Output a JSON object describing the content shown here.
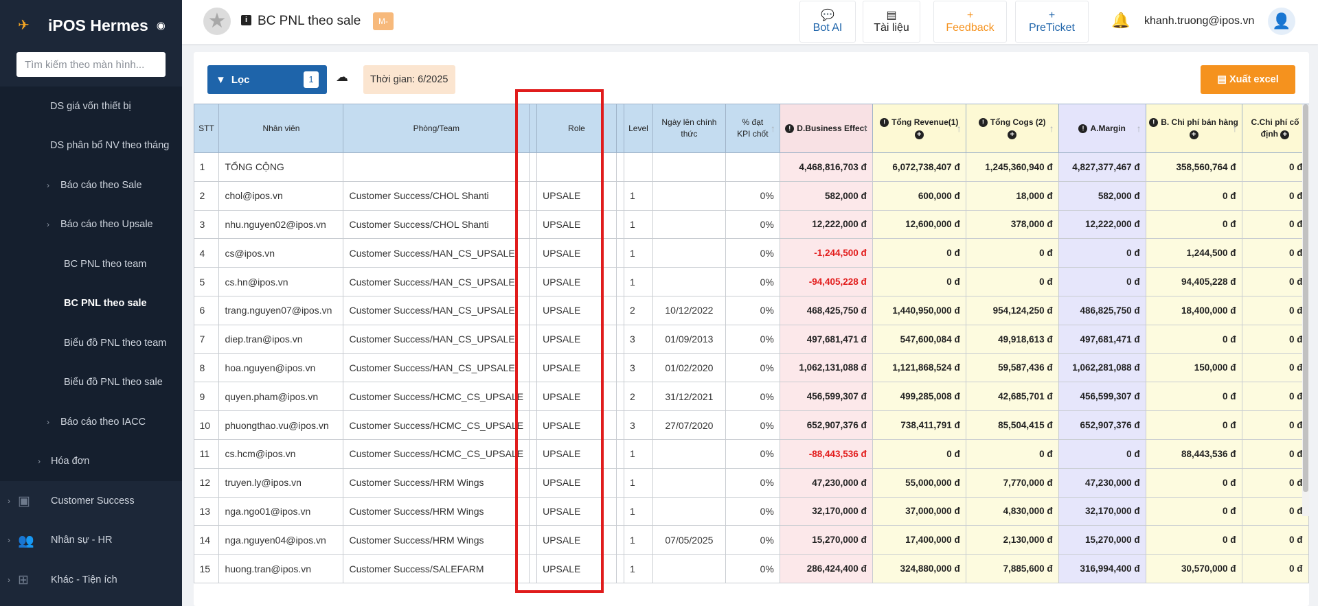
{
  "app": {
    "name": "iPOS Hermes"
  },
  "sidebar": {
    "search_placeholder": "Tìm kiếm theo màn hình...",
    "items": [
      {
        "label": "DS giá vốn thiết bị"
      },
      {
        "label": "DS phân bổ NV theo tháng"
      },
      {
        "label": "Báo cáo theo Sale"
      },
      {
        "label": "Báo cáo theo Upsale"
      },
      {
        "label": "BC PNL theo team"
      },
      {
        "label": "BC PNL theo sale"
      },
      {
        "label": "Biểu đồ PNL theo team"
      },
      {
        "label": "Biểu đồ PNL theo sale"
      },
      {
        "label": "Báo cáo theo IACC"
      },
      {
        "label": "Hóa đơn"
      }
    ],
    "groups": [
      {
        "label": "Customer Success"
      },
      {
        "label": "Nhân sự - HR"
      },
      {
        "label": "Khác - Tiện ích"
      }
    ]
  },
  "topbar": {
    "page_title": "BC PNL theo sale",
    "badge": "M-",
    "buttons": [
      {
        "label": "Bot AI",
        "color": "#1e64aa"
      },
      {
        "label": "Tài liệu",
        "color": "#222222"
      },
      {
        "label": "Feedback",
        "color": "#f5921e"
      },
      {
        "label": "PreTicket",
        "color": "#1e64aa"
      }
    ],
    "user_email": "khanh.truong@ipos.vn"
  },
  "toolbar": {
    "filter_label": "Lọc",
    "filter_count": "1",
    "time_label": "Thời gian: 6/2025",
    "export_label": "Xuất excel"
  },
  "table": {
    "headers": {
      "stt": "STT",
      "employee": "Nhân viên",
      "team": "Phòng/Team",
      "role": "Role",
      "level": "Level",
      "official_date": "Ngày lên chính thức",
      "kpi": "% đạt KPI chốt",
      "business_effect": "D.Business Effect",
      "revenue": "Tổng Revenue(1)",
      "cogs": "Tổng Cogs (2)",
      "margin": "A.Margin",
      "selling_cost": "B. Chi phí bán hàng",
      "fixed_cost": "C.Chi phí cố định"
    },
    "rows": [
      {
        "stt": "1",
        "employee": "TỔNG CỘNG",
        "team": "",
        "role": "",
        "level": "",
        "date": "",
        "kpi": "",
        "be": "4,468,816,703 đ",
        "rev": "6,072,738,407 đ",
        "cogs": "1,245,360,940 đ",
        "margin": "4,827,377,467 đ",
        "sell": "358,560,764 đ",
        "fixed": "0 đ"
      },
      {
        "stt": "2",
        "employee": "chol@ipos.vn",
        "team": "Customer Success/CHOL Shanti",
        "role": "UPSALE",
        "level": "1",
        "date": "",
        "kpi": "0%",
        "be": "582,000 đ",
        "rev": "600,000 đ",
        "cogs": "18,000 đ",
        "margin": "582,000 đ",
        "sell": "0 đ",
        "fixed": "0 đ"
      },
      {
        "stt": "3",
        "employee": "nhu.nguyen02@ipos.vn",
        "team": "Customer Success/CHOL Shanti",
        "role": "UPSALE",
        "level": "1",
        "date": "",
        "kpi": "0%",
        "be": "12,222,000 đ",
        "rev": "12,600,000 đ",
        "cogs": "378,000 đ",
        "margin": "12,222,000 đ",
        "sell": "0 đ",
        "fixed": "0 đ"
      },
      {
        "stt": "4",
        "employee": "cs@ipos.vn",
        "team": "Customer Success/HAN_CS_UPSALE",
        "role": "UPSALE",
        "level": "1",
        "date": "",
        "kpi": "0%",
        "be": "-1,244,500 đ",
        "neg": true,
        "rev": "0 đ",
        "cogs": "0 đ",
        "margin": "0 đ",
        "sell": "1,244,500 đ",
        "fixed": "0 đ"
      },
      {
        "stt": "5",
        "employee": "cs.hn@ipos.vn",
        "team": "Customer Success/HAN_CS_UPSALE",
        "role": "UPSALE",
        "level": "1",
        "date": "",
        "kpi": "0%",
        "be": "-94,405,228 đ",
        "neg": true,
        "rev": "0 đ",
        "cogs": "0 đ",
        "margin": "0 đ",
        "sell": "94,405,228 đ",
        "fixed": "0 đ"
      },
      {
        "stt": "6",
        "employee": "trang.nguyen07@ipos.vn",
        "team": "Customer Success/HAN_CS_UPSALE",
        "role": "UPSALE",
        "level": "2",
        "date": "10/12/2022",
        "kpi": "0%",
        "be": "468,425,750 đ",
        "rev": "1,440,950,000 đ",
        "cogs": "954,124,250 đ",
        "margin": "486,825,750 đ",
        "sell": "18,400,000 đ",
        "fixed": "0 đ"
      },
      {
        "stt": "7",
        "employee": "diep.tran@ipos.vn",
        "team": "Customer Success/HAN_CS_UPSALE",
        "role": "UPSALE",
        "level": "3",
        "date": "01/09/2013",
        "kpi": "0%",
        "be": "497,681,471 đ",
        "rev": "547,600,084 đ",
        "cogs": "49,918,613 đ",
        "margin": "497,681,471 đ",
        "sell": "0 đ",
        "fixed": "0 đ"
      },
      {
        "stt": "8",
        "employee": "hoa.nguyen@ipos.vn",
        "team": "Customer Success/HAN_CS_UPSALE",
        "role": "UPSALE",
        "level": "3",
        "date": "01/02/2020",
        "kpi": "0%",
        "be": "1,062,131,088 đ",
        "rev": "1,121,868,524 đ",
        "cogs": "59,587,436 đ",
        "margin": "1,062,281,088 đ",
        "sell": "150,000 đ",
        "fixed": "0 đ"
      },
      {
        "stt": "9",
        "employee": "quyen.pham@ipos.vn",
        "team": "Customer Success/HCMC_CS_UPSALE",
        "role": "UPSALE",
        "level": "2",
        "date": "31/12/2021",
        "kpi": "0%",
        "be": "456,599,307 đ",
        "rev": "499,285,008 đ",
        "cogs": "42,685,701 đ",
        "margin": "456,599,307 đ",
        "sell": "0 đ",
        "fixed": "0 đ"
      },
      {
        "stt": "10",
        "employee": "phuongthao.vu@ipos.vn",
        "team": "Customer Success/HCMC_CS_UPSALE",
        "role": "UPSALE",
        "level": "3",
        "date": "27/07/2020",
        "kpi": "0%",
        "be": "652,907,376 đ",
        "rev": "738,411,791 đ",
        "cogs": "85,504,415 đ",
        "margin": "652,907,376 đ",
        "sell": "0 đ",
        "fixed": "0 đ"
      },
      {
        "stt": "11",
        "employee": "cs.hcm@ipos.vn",
        "team": "Customer Success/HCMC_CS_UPSALE",
        "role": "UPSALE",
        "level": "1",
        "date": "",
        "kpi": "0%",
        "be": "-88,443,536 đ",
        "neg": true,
        "rev": "0 đ",
        "cogs": "0 đ",
        "margin": "0 đ",
        "sell": "88,443,536 đ",
        "fixed": "0 đ"
      },
      {
        "stt": "12",
        "employee": "truyen.ly@ipos.vn",
        "team": "Customer Success/HRM Wings",
        "role": "UPSALE",
        "level": "1",
        "date": "",
        "kpi": "0%",
        "be": "47,230,000 đ",
        "rev": "55,000,000 đ",
        "cogs": "7,770,000 đ",
        "margin": "47,230,000 đ",
        "sell": "0 đ",
        "fixed": "0 đ"
      },
      {
        "stt": "13",
        "employee": "nga.ngo01@ipos.vn",
        "team": "Customer Success/HRM Wings",
        "role": "UPSALE",
        "level": "1",
        "date": "",
        "kpi": "0%",
        "be": "32,170,000 đ",
        "rev": "37,000,000 đ",
        "cogs": "4,830,000 đ",
        "margin": "32,170,000 đ",
        "sell": "0 đ",
        "fixed": "0 đ"
      },
      {
        "stt": "14",
        "employee": "nga.nguyen04@ipos.vn",
        "team": "Customer Success/HRM Wings",
        "role": "UPSALE",
        "level": "1",
        "date": "07/05/2025",
        "kpi": "0%",
        "be": "15,270,000 đ",
        "rev": "17,400,000 đ",
        "cogs": "2,130,000 đ",
        "margin": "15,270,000 đ",
        "sell": "0 đ",
        "fixed": "0 đ"
      },
      {
        "stt": "15",
        "employee": "huong.tran@ipos.vn",
        "team": "Customer Success/SALEFARM",
        "role": "UPSALE",
        "level": "1",
        "date": "",
        "kpi": "0%",
        "be": "286,424,400 đ",
        "rev": "324,880,000 đ",
        "cogs": "7,885,600 đ",
        "margin": "316,994,400 đ",
        "sell": "30,570,000 đ",
        "fixed": "0 đ"
      }
    ]
  },
  "colors": {
    "sidebar_bg": "#1c2738",
    "primary": "#1e64aa",
    "export": "#f5921e",
    "negative": "#e21b1b",
    "highlight": "#e01c1c"
  }
}
